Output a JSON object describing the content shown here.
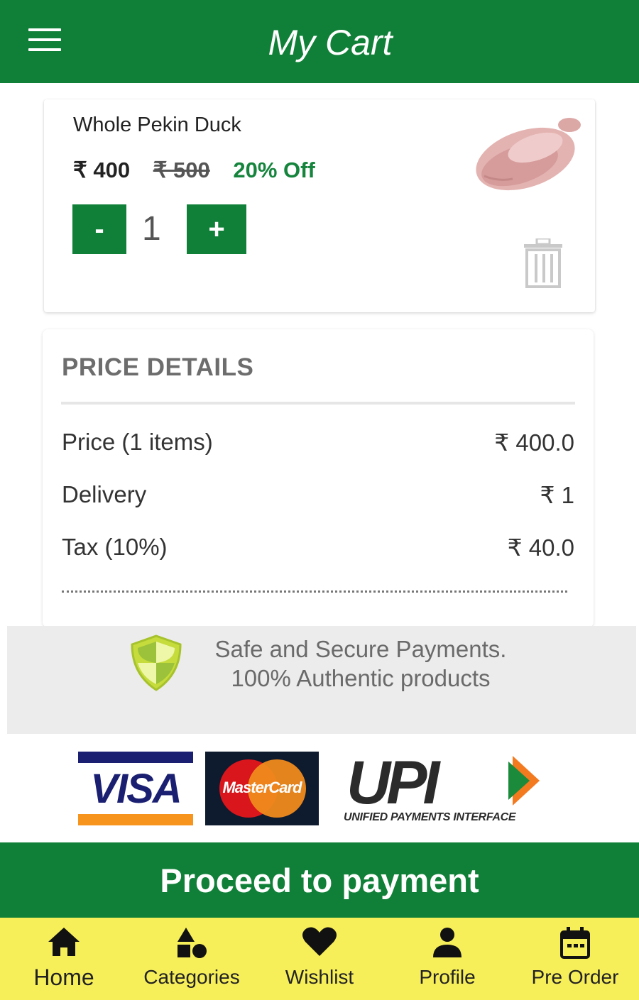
{
  "appbar": {
    "title": "My Cart",
    "menu_icon": "hamburger-menu-icon"
  },
  "cart_item": {
    "name": "Whole Pekin Duck",
    "price": "₹ 400",
    "original_price": "₹ 500",
    "discount": "20% Off",
    "quantity": "1",
    "minus_label": "-",
    "plus_label": "+",
    "image_icon": "duck-image",
    "delete_icon": "trash-icon"
  },
  "price_details": {
    "title": "PRICE DETAILS",
    "rows": [
      {
        "label": "Price (1 items)",
        "value": "₹ 400.0"
      },
      {
        "label": "Delivery",
        "value": "₹ 1"
      },
      {
        "label": "Tax (10%)",
        "value": "₹ 40.0"
      }
    ]
  },
  "secure": {
    "line1": "Safe and Secure Payments.",
    "line2": "100% Authentic products",
    "icon": "shield-icon"
  },
  "payment_logos": {
    "visa": "VISA",
    "mastercard": "MasterCard",
    "upi": "UPI",
    "upi_sub": "UNIFIED PAYMENTS INTERFACE"
  },
  "proceed_label": "Proceed to payment",
  "bottom_nav": [
    {
      "label": "Home",
      "icon": "home-icon"
    },
    {
      "label": "Categories",
      "icon": "categories-icon"
    },
    {
      "label": "Wishlist",
      "icon": "heart-icon"
    },
    {
      "label": "Profile",
      "icon": "person-icon"
    },
    {
      "label": "Pre Order",
      "icon": "calendar-icon"
    }
  ],
  "colors": {
    "primary": "#108038",
    "nav_bg": "#f7ef5a",
    "discount": "#15843c",
    "secure_bg": "#ececec"
  }
}
